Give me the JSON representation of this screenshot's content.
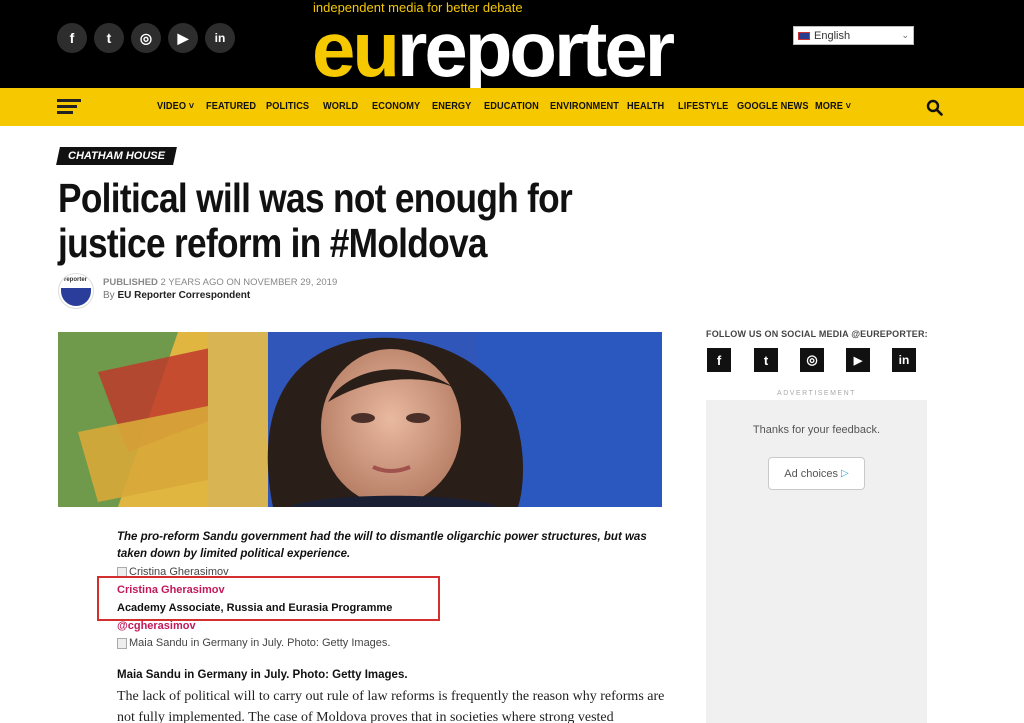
{
  "header": {
    "tagline": "independent media for better debate",
    "logo_eu": "eu",
    "logo_rest": "reporter",
    "language": "English",
    "social": [
      {
        "icon": "facebook-icon",
        "glyph": "f"
      },
      {
        "icon": "twitter-icon",
        "glyph": "t"
      },
      {
        "icon": "instagram-icon",
        "glyph": "◎"
      },
      {
        "icon": "youtube-icon",
        "glyph": "▶"
      },
      {
        "icon": "linkedin-icon",
        "glyph": "in"
      }
    ]
  },
  "nav": {
    "items": [
      "VIDEO ˅",
      "FEATURED",
      "POLITICS",
      "WORLD",
      "ECONOMY",
      "ENERGY",
      "EDUCATION",
      "ENVIRONMENT",
      "HEALTH",
      "LIFESTYLE",
      "GOOGLE NEWS",
      "MORE ˅"
    ]
  },
  "article": {
    "category": "CHATHAM HOUSE",
    "headline": "Political will was not enough for justice reform in #Moldova",
    "published_prefix": "PUBLISHED",
    "published": "2 YEARS AGO ON NOVEMBER 29, 2019",
    "by_prefix": "By",
    "author": "EU Reporter Correspondent",
    "avatar_text": "reporter",
    "lead": "The pro-reform Sandu government had the will to dismantle oligarchic power structures, but was taken down by limited political experience.",
    "author_img_alt": "Cristina Gherasimov",
    "contributor_name": "Cristina Gherasimov",
    "contributor_role": "Academy Associate, Russia and Eurasia Programme",
    "contributor_handle": "@cgherasimov",
    "photo_alt": "Maia Sandu in Germany in July. Photo: Getty Images.",
    "caption": "Maia Sandu in Germany in July. Photo: Getty Images.",
    "body": "The lack of political will to carry out rule of law reforms is frequently the reason why reforms are not fully implemented. The case of Moldova proves that in societies where strong vested"
  },
  "sidebar": {
    "follow": "FOLLOW US ON SOCIAL MEDIA @EUREPORTER:",
    "social": [
      {
        "icon": "facebook-icon",
        "glyph": "f"
      },
      {
        "icon": "twitter-icon",
        "glyph": "t"
      },
      {
        "icon": "instagram-icon",
        "glyph": "◎"
      },
      {
        "icon": "youtube-icon",
        "glyph": "▶"
      },
      {
        "icon": "linkedin-icon",
        "glyph": "in"
      }
    ],
    "ad_label": "ADVERTISEMENT",
    "ad_thanks": "Thanks for your feedback.",
    "ad_choices": "Ad choices"
  },
  "colors": {
    "brand_yellow": "#f5c800",
    "header_black": "#000000",
    "link_pink": "#c2185b",
    "highlight_red": "#d32f2f"
  }
}
